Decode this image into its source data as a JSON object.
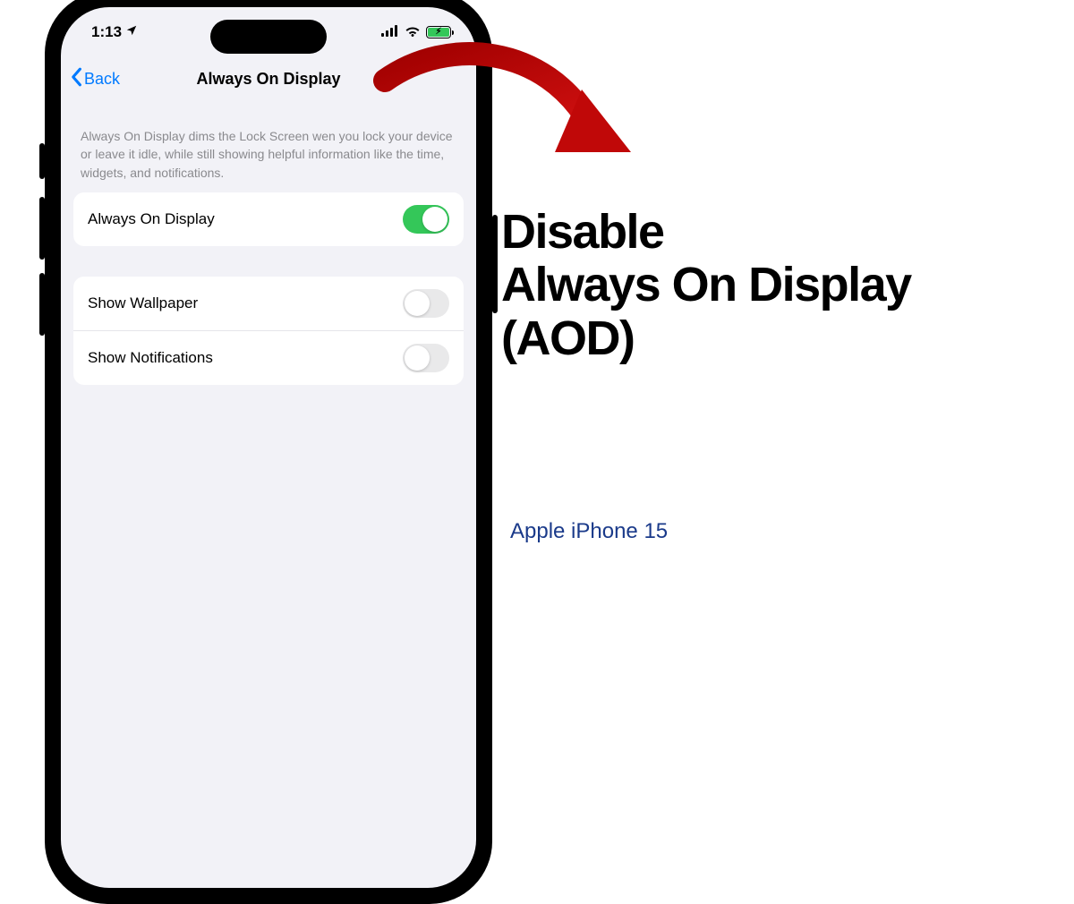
{
  "statusbar": {
    "time": "1:13"
  },
  "nav": {
    "back_label": "Back",
    "title": "Always On Display"
  },
  "description": "Always On Display dims the Lock Screen wen you lock your device or leave it idle, while still showing helpful information like the time, widgets, and notifications.",
  "settings": {
    "group1": [
      {
        "label": "Always On Display",
        "on": true
      }
    ],
    "group2": [
      {
        "label": "Show Wallpaper",
        "on": false
      },
      {
        "label": "Show Notifications",
        "on": false
      }
    ]
  },
  "headline": {
    "line1": "Disable",
    "line2": "Always On Display",
    "line3": "(AOD)"
  },
  "subhead": "Apple iPhone 15"
}
